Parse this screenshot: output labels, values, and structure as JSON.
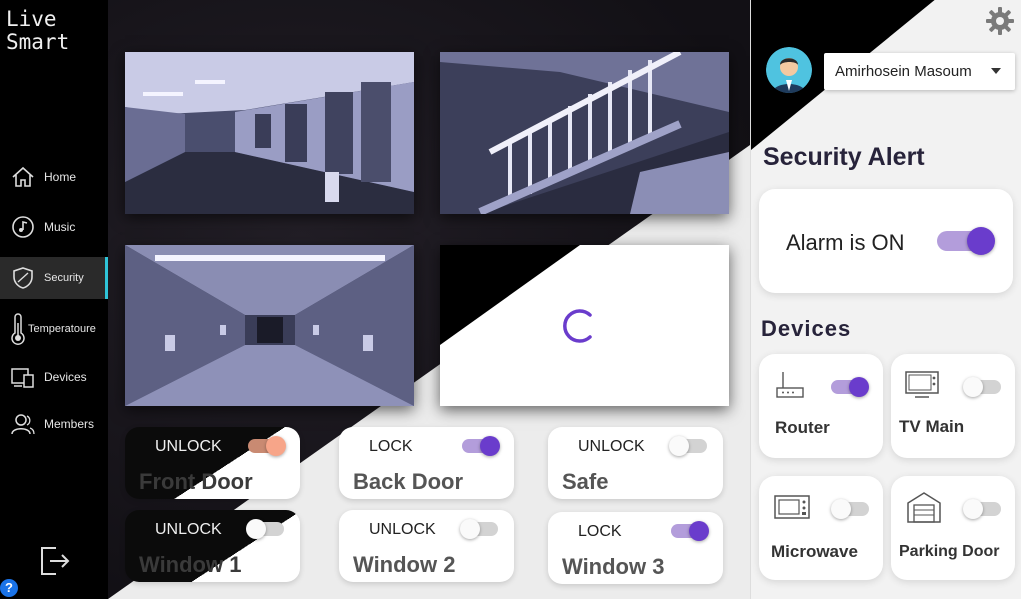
{
  "app": {
    "logo_line1": "Live",
    "logo_line2": "Smart"
  },
  "sidebar": {
    "items": [
      {
        "label": "Home",
        "icon": "home-icon"
      },
      {
        "label": "Music",
        "icon": "music-icon"
      },
      {
        "label": "Security",
        "icon": "shield-icon",
        "active": true
      },
      {
        "label": "Temperatoure",
        "icon": "thermometer-icon"
      },
      {
        "label": "Devices",
        "icon": "devices-icon"
      },
      {
        "label": "Members",
        "icon": "members-icon"
      }
    ],
    "exit_icon": "logout-icon",
    "help_label": "?"
  },
  "cameras": [
    {
      "name": "corridor-camera",
      "status": "live"
    },
    {
      "name": "stairwell-camera",
      "status": "live"
    },
    {
      "name": "hallway-camera",
      "status": "live"
    },
    {
      "name": "loading-camera",
      "status": "loading"
    }
  ],
  "locks": [
    {
      "name": "Front Door",
      "state": "UNLOCK",
      "on": true
    },
    {
      "name": "Back Door",
      "state": "LOCK",
      "on": true
    },
    {
      "name": "Safe",
      "state": "UNLOCK",
      "on": false
    },
    {
      "name": "Window 1",
      "state": "UNLOCK",
      "on": false
    },
    {
      "name": "Window 2",
      "state": "UNLOCK",
      "on": false
    },
    {
      "name": "Window 3",
      "state": "LOCK",
      "on": true
    }
  ],
  "header": {
    "user_name": "Amirhosein Masoum",
    "settings_icon": "gear-icon"
  },
  "security": {
    "title": "Security Alert",
    "alarm_label": "Alarm is ON",
    "alarm_on": true
  },
  "devices": {
    "title": "Devices",
    "items": [
      {
        "name": "Router",
        "icon": "router-icon",
        "on": true
      },
      {
        "name": "TV Main",
        "icon": "tv-icon",
        "on": false
      },
      {
        "name": "Microwave",
        "icon": "microwave-icon",
        "on": false
      },
      {
        "name": "Parking Door",
        "icon": "garage-icon",
        "on": false
      }
    ]
  },
  "colors": {
    "accent": "#6a3ccc",
    "accent_track": "#b39ddb",
    "active_nav": "#2fc4d8",
    "orange_knob": "#f7a589"
  }
}
